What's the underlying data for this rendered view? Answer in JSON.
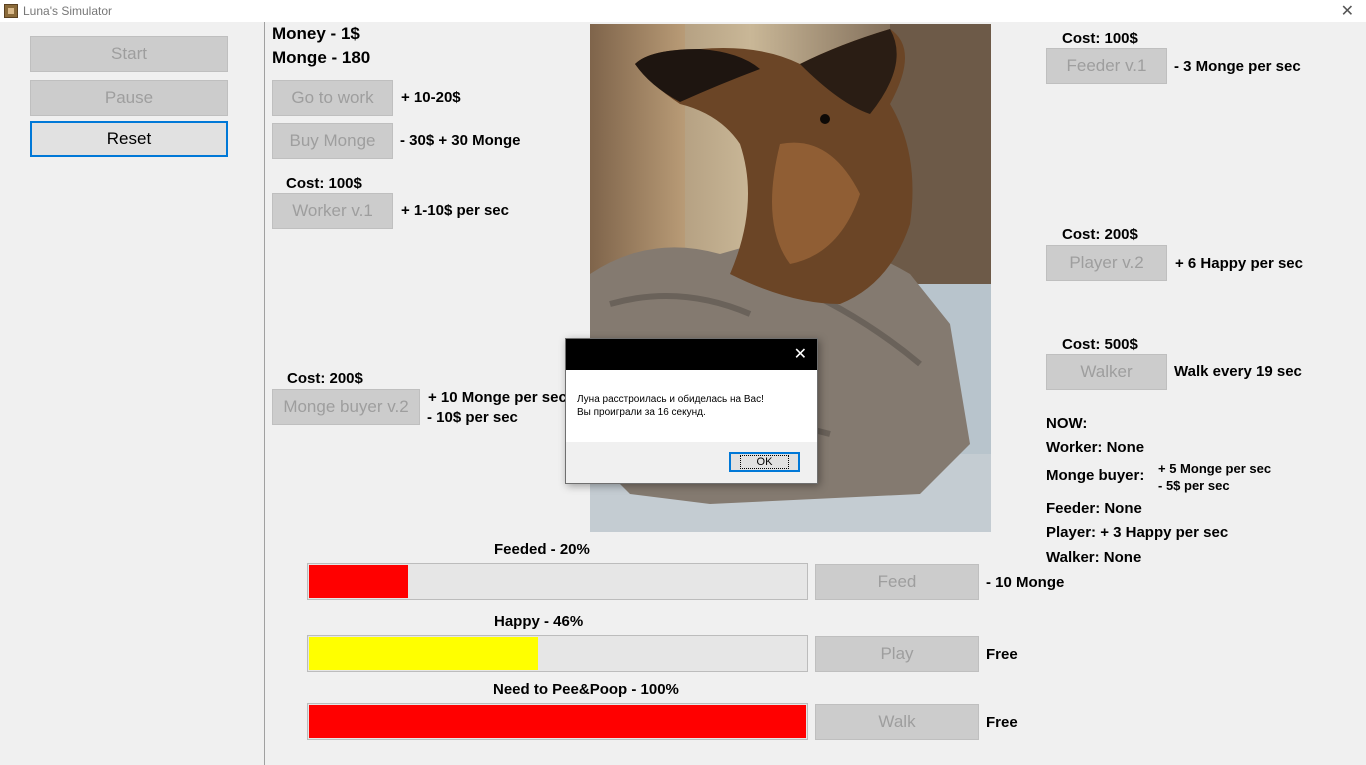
{
  "window": {
    "title": "Luna's Simulator"
  },
  "sidebar": {
    "start_label": "Start",
    "pause_label": "Pause",
    "reset_label": "Reset"
  },
  "stats": {
    "money": "Money - 1$",
    "monge": "Monge - 180"
  },
  "actions": {
    "work_label": "Go to work",
    "work_desc": "+ 10-20$",
    "buy_monge_label": "Buy Monge",
    "buy_monge_desc": "- 30$ + 30 Monge"
  },
  "upgrades_left": {
    "worker_cost": "Cost: 100$",
    "worker_label": "Worker v.1",
    "worker_desc": "+ 1-10$ per sec",
    "buyer_cost": "Cost: 200$",
    "buyer_label": "Monge buyer v.2",
    "buyer_desc_1": "+ 10 Monge per sec",
    "buyer_desc_2": "- 10$ per sec"
  },
  "upgrades_right": {
    "feeder_cost": "Cost: 100$",
    "feeder_label": "Feeder v.1",
    "feeder_desc": "- 3 Monge per sec",
    "player_cost": "Cost: 200$",
    "player_label": "Player v.2",
    "player_desc": "+ 6 Happy per sec",
    "walker_cost": "Cost: 500$",
    "walker_label": "Walker",
    "walker_desc": "Walk every 19 sec"
  },
  "now": {
    "heading": "NOW:",
    "worker": "Worker: None",
    "buyer_label": "Monge buyer:",
    "buyer_1": "+ 5 Monge per sec",
    "buyer_2": "- 5$ per sec",
    "feeder": "Feeder: None",
    "player": "Player: + 3 Happy per sec",
    "walker": "Walker: None"
  },
  "meters": {
    "feeded_label": "Feeded - 20%",
    "feeded_value": 0.2,
    "feeded_color": "#ff0000",
    "feed_btn": "Feed",
    "feed_cost": "- 10 Monge",
    "happy_label": "Happy - 46%",
    "happy_value": 0.46,
    "happy_color": "#ffff00",
    "play_btn": "Play",
    "play_cost": "Free",
    "pee_label": "Need to Pee&Poop - 100%",
    "pee_value": 1.0,
    "pee_color": "#ff0000",
    "walk_btn": "Walk",
    "walk_cost": "Free"
  },
  "dialog": {
    "line1": "Луна расстроилась и обиделась на Вас!",
    "line2": "Вы проиграли за 16 секунд.",
    "ok_label": "OK"
  },
  "icons": {
    "app": "dog-app-icon",
    "close": "close-icon"
  }
}
